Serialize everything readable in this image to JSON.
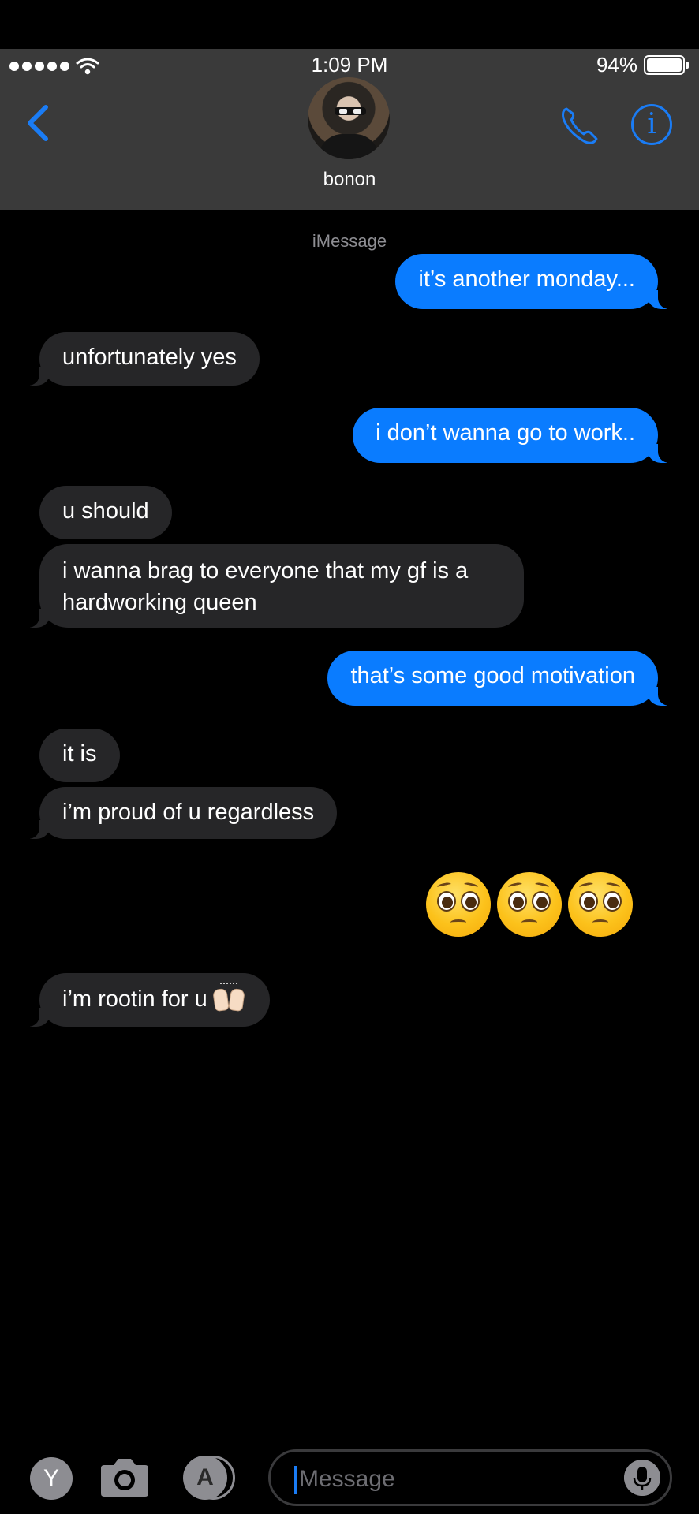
{
  "status": {
    "time": "1:09 PM",
    "battery": "94%",
    "signal_dots": 5,
    "battery_level": 0.94
  },
  "header": {
    "contact_name": "bonon"
  },
  "conversation": {
    "service_label": "iMessage",
    "messages": [
      {
        "sender": "me",
        "text": "it’s another monday..."
      },
      {
        "sender": "them",
        "text": "unfortunately yes"
      },
      {
        "sender": "me",
        "text": "i don’t wanna go to work.."
      },
      {
        "sender": "them",
        "text": "u should"
      },
      {
        "sender": "them",
        "text": "i wanna brag to everyone that my gf is a hardworking queen"
      },
      {
        "sender": "me",
        "text": "that’s some good motivation"
      },
      {
        "sender": "them",
        "text": "it is"
      },
      {
        "sender": "them",
        "text": "i’m proud of u regardless"
      },
      {
        "sender": "me",
        "emoji": "pleading-face x3"
      },
      {
        "sender": "them",
        "text": "i’m rootin for u",
        "emoji": "raising-hands"
      }
    ]
  },
  "input_bar": {
    "placeholder": "Message",
    "app_button_label": "Y",
    "appstore_glyph": "A"
  },
  "colors": {
    "accent": "#1a7cf5",
    "sent_bubble": "#0a7cff",
    "received_bubble": "#262628",
    "header_bg": "#3a3a3a"
  }
}
